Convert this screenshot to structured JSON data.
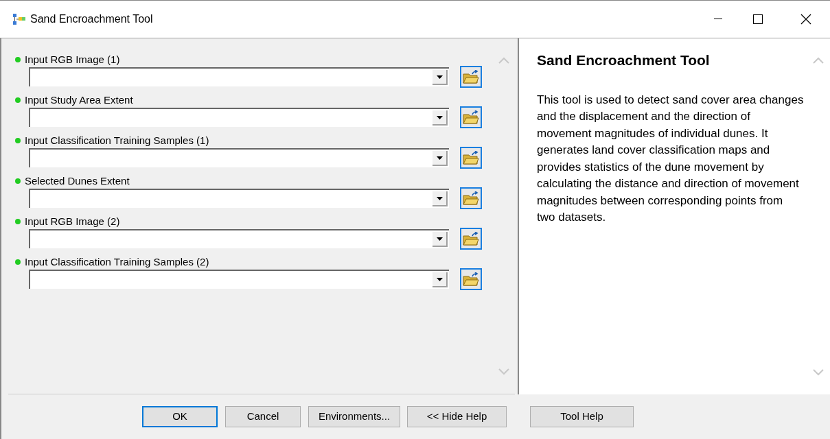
{
  "window": {
    "title": "Sand Encroachment Tool"
  },
  "parameters": [
    {
      "label": "Input RGB Image (1)",
      "color": "#22cc22"
    },
    {
      "label": "Input Study Area Extent",
      "color": "#22cc22"
    },
    {
      "label": "Input Classification Training Samples (1)",
      "color": "#22cc22"
    },
    {
      "label": "Selected Dunes Extent",
      "color": "#22cc22"
    },
    {
      "label": "Input RGB Image (2)",
      "color": "#22cc22"
    },
    {
      "label": "Input Classification Training Samples (2)",
      "color": "#22cc22"
    }
  ],
  "help": {
    "title": "Sand Encroachment Tool",
    "body": "This tool is used to detect sand cover area changes and the displacement and the direction of movement magnitudes of individual dunes. It generates land cover classification maps and provides statistics of the dune movement by calculating the distance and direction of movement magnitudes between corresponding points from two datasets."
  },
  "buttons": [
    {
      "label": "OK",
      "focused": true
    },
    {
      "label": "Cancel",
      "focused": false
    },
    {
      "label": "Environments...",
      "focused": false
    },
    {
      "label": "<< Hide Help",
      "focused": false
    },
    {
      "label": "Tool Help",
      "focused": false
    }
  ]
}
